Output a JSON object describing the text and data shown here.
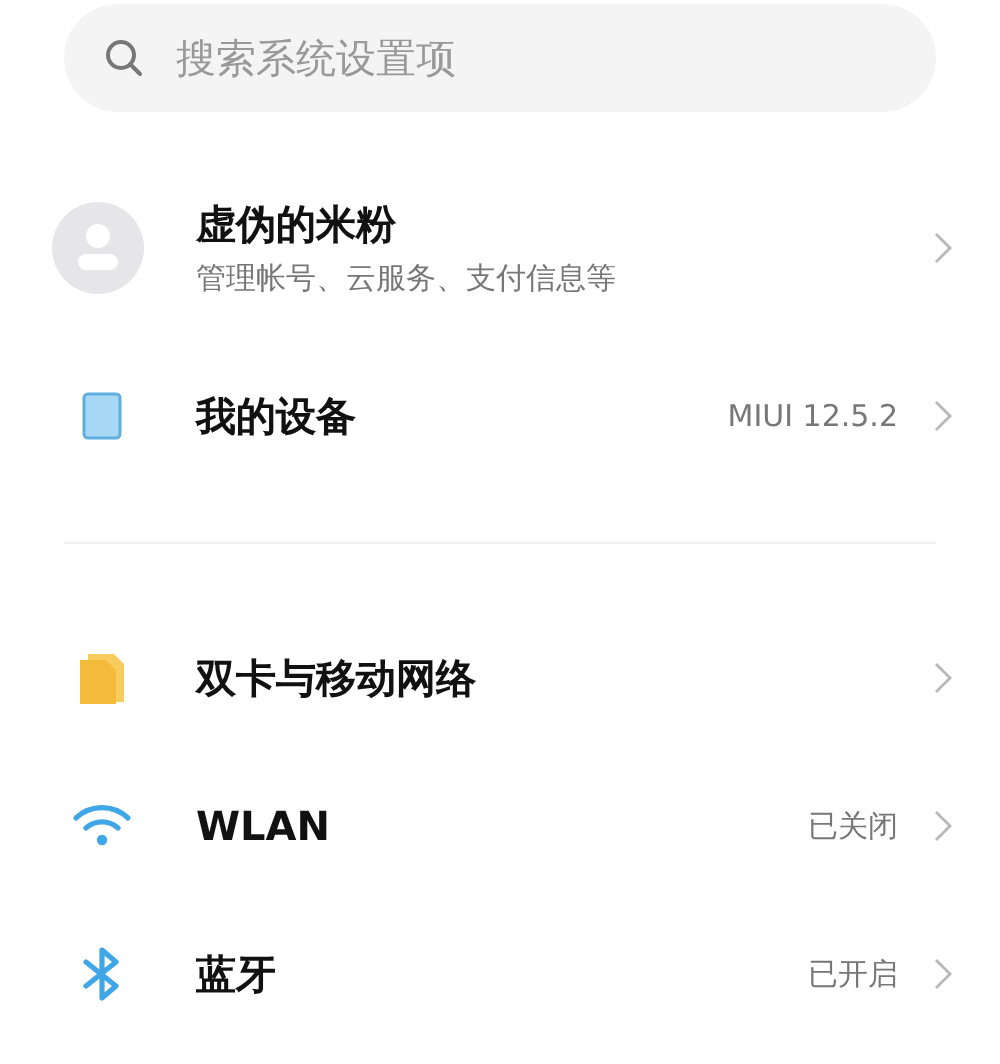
{
  "search": {
    "placeholder": "搜索系统设置项"
  },
  "account": {
    "name": "虚伪的米粉",
    "subtitle": "管理帐号、云服务、支付信息等"
  },
  "sections": [
    [
      {
        "kind": "device",
        "label": "我的设备",
        "value": "MIUI 12.5.2"
      }
    ],
    [
      {
        "kind": "sim",
        "label": "双卡与移动网络"
      },
      {
        "kind": "wifi",
        "label": "WLAN",
        "value": "已关闭"
      },
      {
        "kind": "bluetooth",
        "label": "蓝牙",
        "value": "已开启"
      }
    ]
  ]
}
